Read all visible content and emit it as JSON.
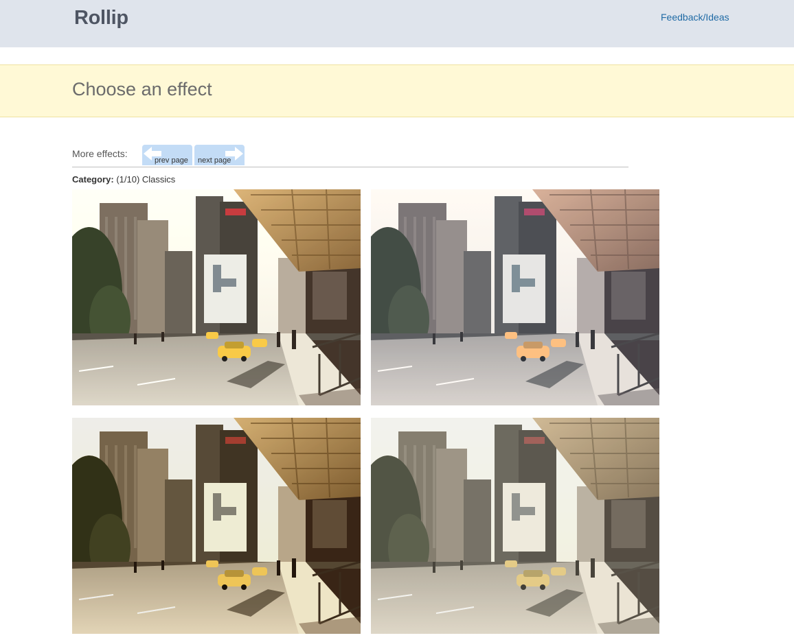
{
  "header": {
    "logo": "Rollip",
    "feedback_link": "Feedback/Ideas"
  },
  "banner": {
    "title": "Choose an effect"
  },
  "effects_nav": {
    "label": "More effects:",
    "prev_label": "prev page",
    "next_label": "next page"
  },
  "category": {
    "label": "Category:",
    "value": "(1/10) Classics"
  },
  "thumbnails": [
    {
      "tint": "#f5e8c8"
    },
    {
      "tint": "#b9cfe6"
    },
    {
      "tint": "#d8b27a"
    },
    {
      "tint": "#c9c6a8"
    }
  ],
  "colors": {
    "topbar": "#dfe4ec",
    "banner": "#fff9d6",
    "link": "#1f6aa5",
    "nav_button": "#c3dcf6"
  }
}
